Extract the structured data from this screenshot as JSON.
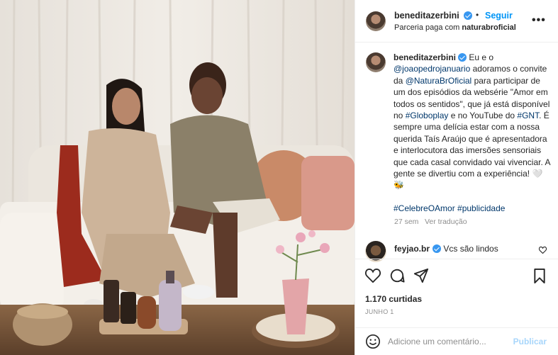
{
  "post": {
    "username": "beneditazerbini",
    "follow_label": "Seguir",
    "separator": "•",
    "partnership_prefix": "Parceria paga com ",
    "partner_name": "naturabroficial",
    "more_label": "•••"
  },
  "caption": {
    "username": "beneditazerbini",
    "p1": " Eu e o ",
    "mention1": "@joaopedrojanuario",
    "p2": " adoramos o convite da ",
    "mention2": "@NaturaBrOficial",
    "p3": " para participar de um dos episódios da websérie \"Amor em todos os sentidos\", que já está disponível no ",
    "tag1": "#Globoplay",
    "p4": " e no YouTube do ",
    "tag2": "#GNT",
    "p5": ". É sempre uma delícia estar com a nossa querida Taís Araújo que é apresentadora e interlocutora das imersões sensoriais que cada casal convidado vai vivenciar. A gente se divertiu com a experiência! 🤍🐝",
    "hashtags": "#CelebreOAmor #publicidade",
    "time": "27 sem",
    "translate_label": "Ver tradução"
  },
  "comment": {
    "username": "feyjao.br",
    "text": " Vcs são lindos"
  },
  "actions": {
    "likes": "1.170 curtidas",
    "date": "JUNHO 1"
  },
  "comment_bar": {
    "placeholder": "Adicione um comentário...",
    "publish_label": "Publicar"
  },
  "icons": {
    "like": "heart-icon",
    "comment": "speech-bubble-icon",
    "share": "paper-plane-icon",
    "save": "bookmark-icon",
    "emoji": "smiley-icon",
    "comment_like": "heart-icon"
  },
  "colors": {
    "link": "#0095f6",
    "mention": "#00376b",
    "verified": "#3897f0",
    "muted": "#8e8e8e",
    "publish_disabled": "#a8d6fb"
  }
}
